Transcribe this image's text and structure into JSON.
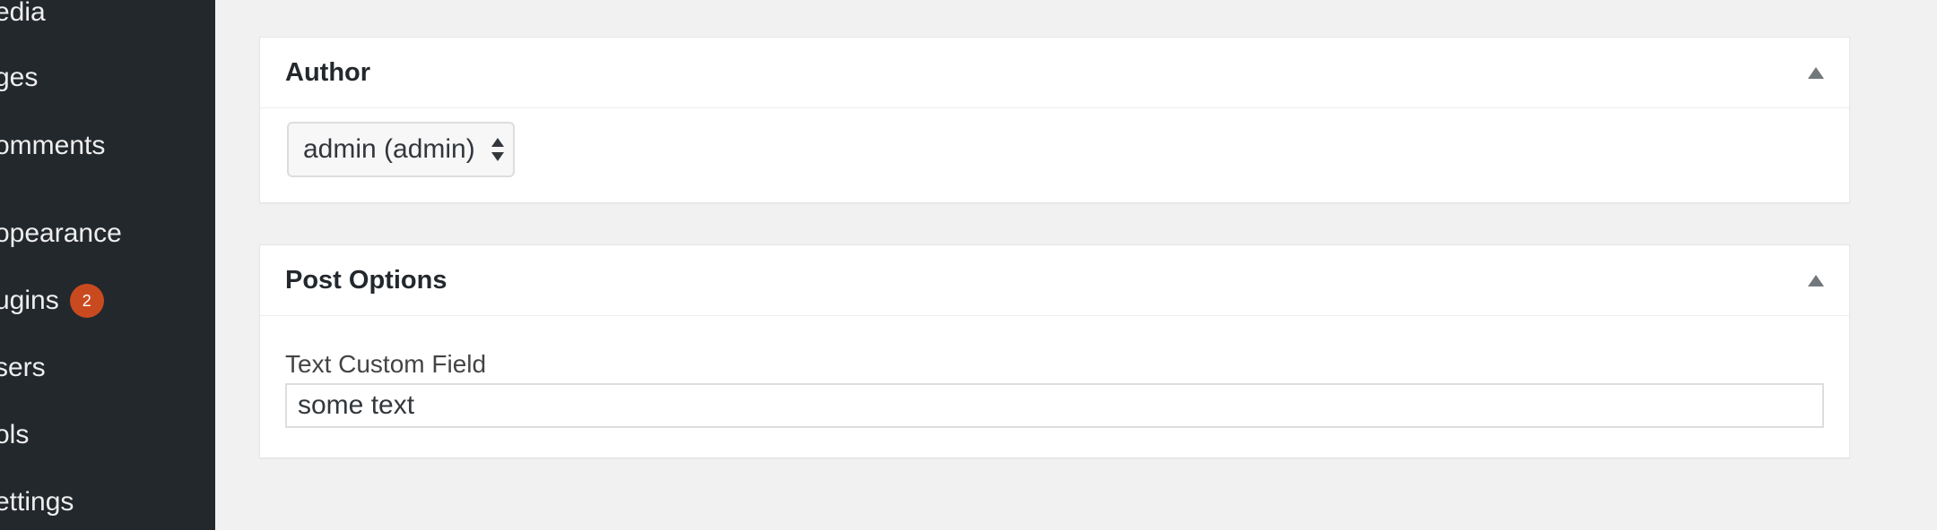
{
  "sidebar": {
    "items": [
      {
        "label": "edia"
      },
      {
        "label": "ges"
      },
      {
        "label": "omments"
      },
      {
        "label": "opearance"
      },
      {
        "label": "ugins",
        "badge": "2"
      },
      {
        "label": "sers"
      },
      {
        "label": "ols"
      },
      {
        "label": "ettings"
      }
    ]
  },
  "author_box": {
    "title": "Author",
    "author_select": {
      "selected": "admin (admin)"
    }
  },
  "post_options_box": {
    "title": "Post Options",
    "text_field": {
      "label": "Text Custom Field",
      "value": "some text"
    }
  },
  "icons": {
    "toggle": "triangle-up-icon",
    "select_arrows": "updown-arrows-icon"
  },
  "colors": {
    "sidebar_bg": "#23282d",
    "page_bg": "#f1f1f1",
    "badge": "#ca4a1f"
  }
}
